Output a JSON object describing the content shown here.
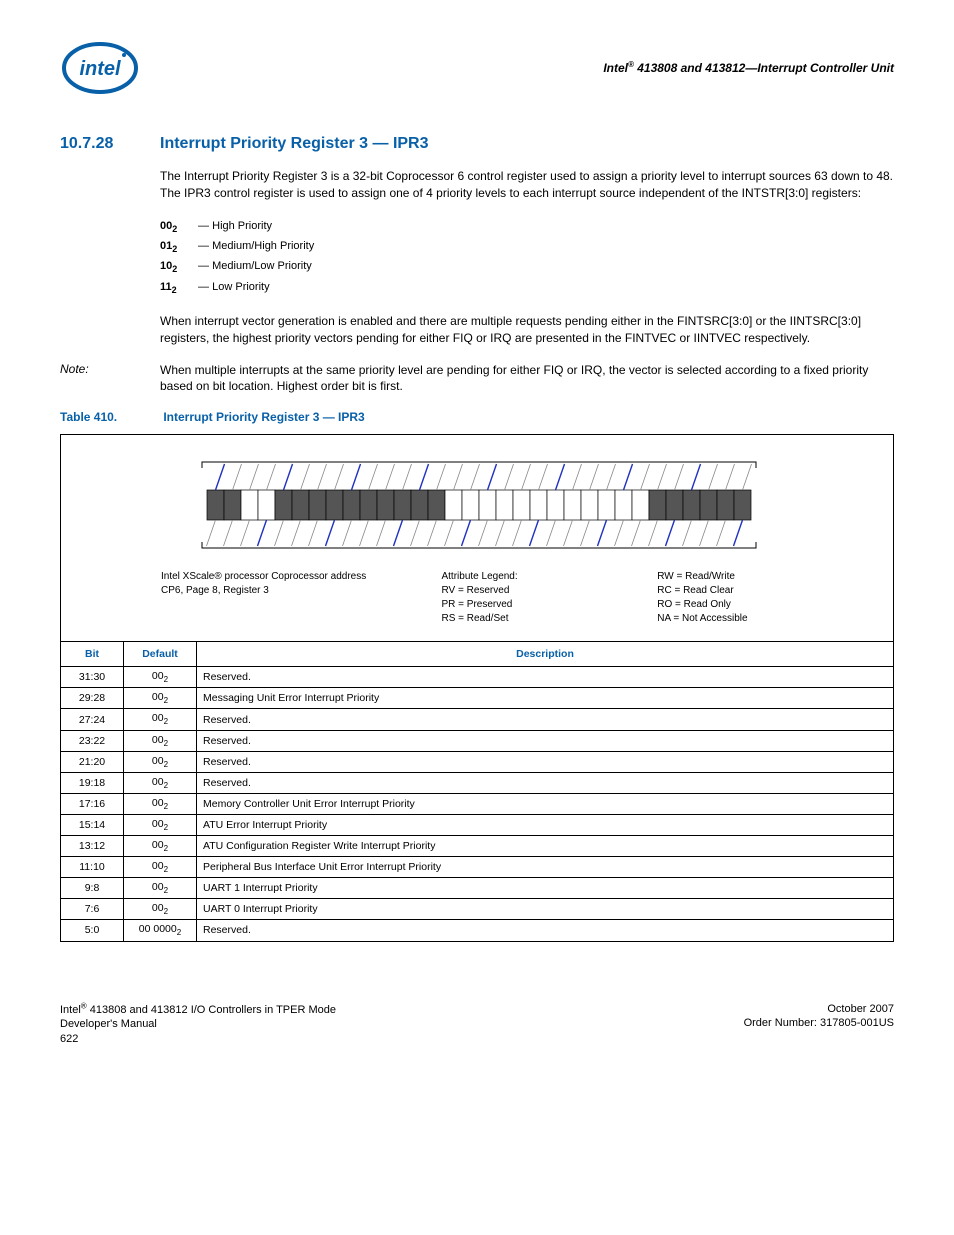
{
  "header": {
    "doc_title": "Intel® 413808 and 413812—Interrupt Controller Unit"
  },
  "section": {
    "number": "10.7.28",
    "title": "Interrupt Priority Register 3 — IPR3",
    "para1": "The Interrupt Priority Register 3 is a 32-bit Coprocessor 6 control register used to assign a priority level to interrupt sources 63 down to 48.   The IPR3 control register is used to assign one of 4 priority levels to each interrupt source independent of the INTSTR[3:0] registers:",
    "priorities": [
      {
        "code": "00",
        "sub": "2",
        "label": "High Priority"
      },
      {
        "code": "01",
        "sub": "2",
        "label": "Medium/High Priority"
      },
      {
        "code": "10",
        "sub": "2",
        "label": "Medium/Low Priority"
      },
      {
        "code": "11",
        "sub": "2",
        "label": "Low Priority"
      }
    ],
    "para2": "When interrupt vector generation is enabled and there are multiple requests pending either in the FINTSRC[3:0] or the IINTSRC[3:0] registers, the highest priority vectors pending for either FIQ or IRQ are presented in the FINTVEC or IINTVEC respectively.",
    "note_label": "Note:",
    "note_text": "When multiple interrupts at the same priority level are pending for either FIQ or IRQ, the vector is selected according to a fixed priority based on bit location. Highest order bit is first."
  },
  "table": {
    "label": "Table 410.",
    "title": "Interrupt Priority Register 3 — IPR3",
    "diagram": {
      "addr_line1": "Intel XScale® processor Coprocessor address",
      "addr_line2": "CP6, Page 8, Register 3",
      "legend_title": "Attribute Legend:",
      "legend_left": [
        "RV = Reserved",
        "PR = Preserved",
        "RS = Read/Set"
      ],
      "legend_right": [
        "RW = Read/Write",
        "RC = Read Clear",
        "RO = Read Only",
        "NA = Not Accessible"
      ]
    },
    "headers": [
      "Bit",
      "Default",
      "Description"
    ],
    "rows": [
      {
        "bit": "31:30",
        "def": "00",
        "sub": "2",
        "desc": "Reserved."
      },
      {
        "bit": "29:28",
        "def": "00",
        "sub": "2",
        "desc": "Messaging Unit Error Interrupt Priority"
      },
      {
        "bit": "27:24",
        "def": "00",
        "sub": "2",
        "desc": "Reserved."
      },
      {
        "bit": "23:22",
        "def": "00",
        "sub": "2",
        "desc": "Reserved."
      },
      {
        "bit": "21:20",
        "def": "00",
        "sub": "2",
        "desc": "Reserved."
      },
      {
        "bit": "19:18",
        "def": "00",
        "sub": "2",
        "desc": "Reserved."
      },
      {
        "bit": "17:16",
        "def": "00",
        "sub": "2",
        "desc": "Memory Controller Unit Error Interrupt Priority"
      },
      {
        "bit": "15:14",
        "def": "00",
        "sub": "2",
        "desc": "ATU Error Interrupt Priority"
      },
      {
        "bit": "13:12",
        "def": "00",
        "sub": "2",
        "desc": "ATU Configuration Register Write Interrupt Priority"
      },
      {
        "bit": "11:10",
        "def": "00",
        "sub": "2",
        "desc": "Peripheral Bus Interface Unit Error Interrupt Priority"
      },
      {
        "bit": "9:8",
        "def": "00",
        "sub": "2",
        "desc": "UART 1 Interrupt Priority"
      },
      {
        "bit": "7:6",
        "def": "00",
        "sub": "2",
        "desc": "UART 0 Interrupt Priority"
      },
      {
        "bit": "5:0",
        "def": "00 0000",
        "sub": "2",
        "desc": "Reserved."
      }
    ]
  },
  "footer": {
    "left_line1": "Intel® 413808 and 413812 I/O Controllers in TPER Mode",
    "left_line2": "Developer's Manual",
    "left_line3": "622",
    "right_line1": "October 2007",
    "right_line2": "Order Number: 317805-001US"
  },
  "chart_data": {
    "type": "table",
    "title": "Interrupt Priority Register 3 — IPR3 bit layout (32-bit register, bits 31..0)",
    "bit_fields": [
      {
        "bits": "31:30",
        "shaded": true
      },
      {
        "bits": "29:28",
        "shaded": false
      },
      {
        "bits": "27:24",
        "shaded": true
      },
      {
        "bits": "23:22",
        "shaded": true
      },
      {
        "bits": "21:20",
        "shaded": true
      },
      {
        "bits": "19:18",
        "shaded": true
      },
      {
        "bits": "17:16",
        "shaded": false
      },
      {
        "bits": "15:14",
        "shaded": false
      },
      {
        "bits": "13:12",
        "shaded": false
      },
      {
        "bits": "11:10",
        "shaded": false
      },
      {
        "bits": "9:8",
        "shaded": false
      },
      {
        "bits": "7:6",
        "shaded": false
      },
      {
        "bits": "5:0",
        "shaded": true
      }
    ]
  }
}
